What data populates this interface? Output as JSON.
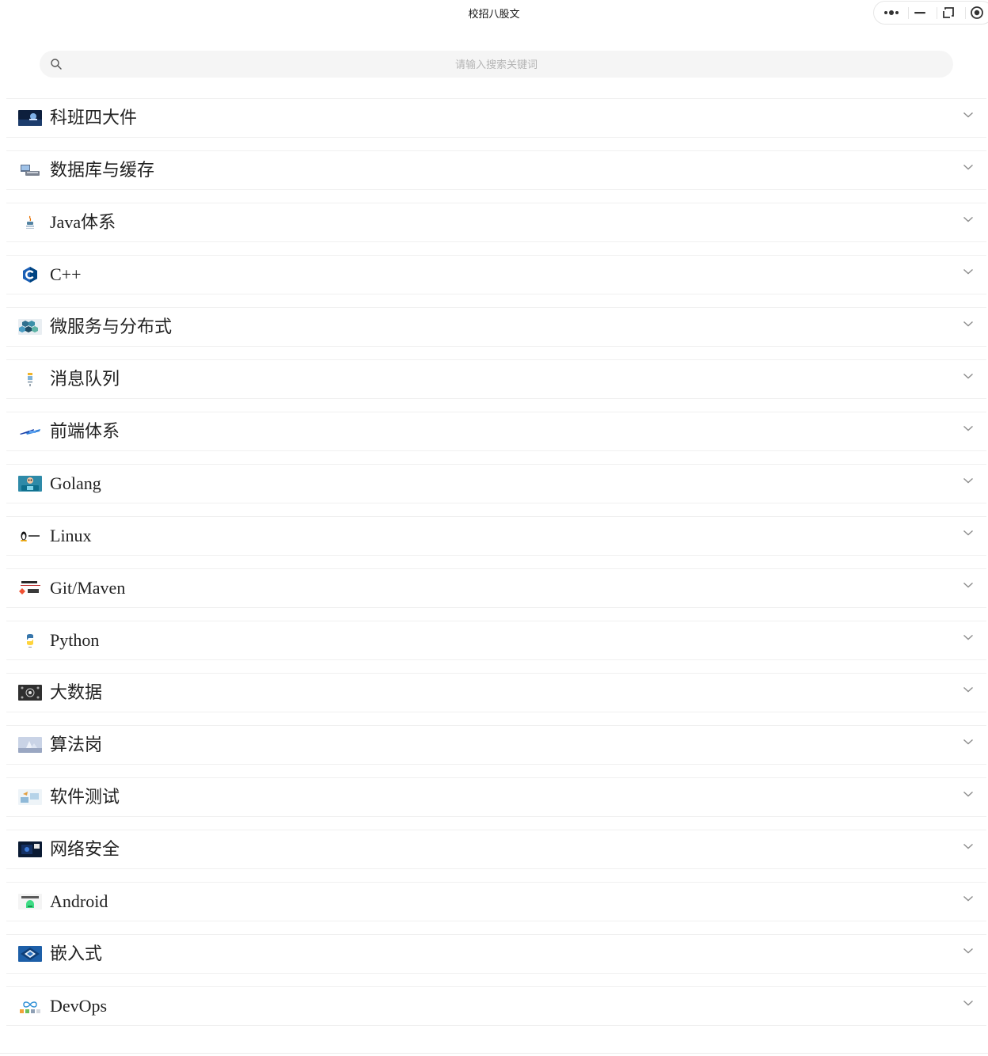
{
  "window": {
    "title": "校招八股文",
    "controls": [
      "more-icon",
      "minimize-icon",
      "restore-icon",
      "close-icon"
    ]
  },
  "search": {
    "placeholder": "请输入搜索关键词",
    "icon": "search-icon"
  },
  "colors": {
    "background": "#ffffff",
    "search_bg": "#f5f5f5",
    "placeholder": "#b5b5b5",
    "divider": "#f0f0f0",
    "chevron": "#8c8c8c"
  },
  "categories": [
    {
      "label": "科班四大件",
      "icon": "cs-fundamentals-thumbnail",
      "expanded": false
    },
    {
      "label": "数据库与缓存",
      "icon": "database-thumbnail",
      "expanded": false
    },
    {
      "label": "Java体系",
      "icon": "java-logo-thumbnail",
      "expanded": false
    },
    {
      "label": "C++",
      "icon": "cpp-logo-thumbnail",
      "expanded": false
    },
    {
      "label": "微服务与分布式",
      "icon": "microservices-hexagon-thumbnail",
      "expanded": false
    },
    {
      "label": "消息队列",
      "icon": "message-queue-thumbnail",
      "expanded": false
    },
    {
      "label": "前端体系",
      "icon": "web-frontend-thumbnail",
      "expanded": false
    },
    {
      "label": "Golang",
      "icon": "golang-gopher-thumbnail",
      "expanded": false
    },
    {
      "label": "Linux",
      "icon": "linux-penguin-thumbnail",
      "expanded": false
    },
    {
      "label": "Git/Maven",
      "icon": "git-maven-thumbnail",
      "expanded": false
    },
    {
      "label": "Python",
      "icon": "python-logo-thumbnail",
      "expanded": false
    },
    {
      "label": "大数据",
      "icon": "big-data-thumbnail",
      "expanded": false
    },
    {
      "label": "算法岗",
      "icon": "algorithm-thumbnail",
      "expanded": false
    },
    {
      "label": "软件测试",
      "icon": "software-testing-thumbnail",
      "expanded": false
    },
    {
      "label": "网络安全",
      "icon": "network-security-thumbnail",
      "expanded": false
    },
    {
      "label": "Android",
      "icon": "android-logo-thumbnail",
      "expanded": false
    },
    {
      "label": "嵌入式",
      "icon": "embedded-chip-thumbnail",
      "expanded": false
    },
    {
      "label": "DevOps",
      "icon": "devops-thumbnail",
      "expanded": false
    }
  ]
}
